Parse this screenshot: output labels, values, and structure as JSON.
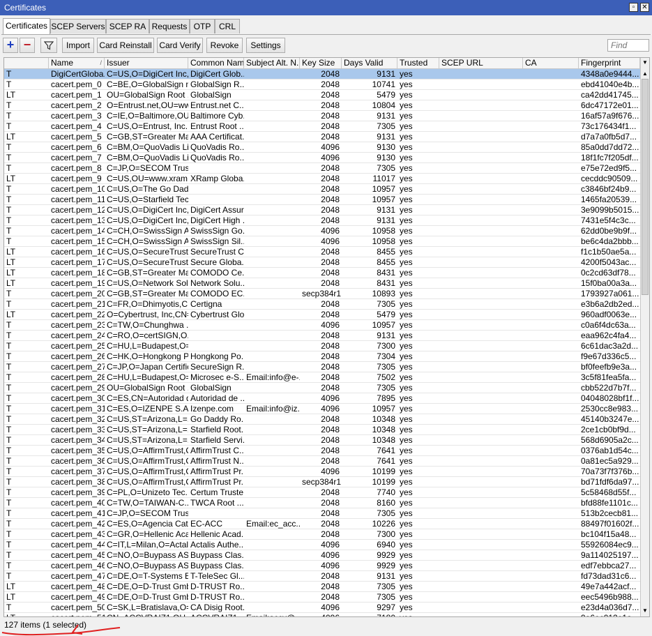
{
  "window": {
    "title": "Certificates"
  },
  "tabs": [
    "Certificates",
    "SCEP Servers",
    "SCEP RA",
    "Requests",
    "OTP",
    "CRL"
  ],
  "toolbar": {
    "add_symbol": "+",
    "remove_symbol": "−",
    "filter_icon": "filter-icon",
    "import_label": "Import",
    "card_reinstall_label": "Card Reinstall",
    "card_verify_label": "Card Verify",
    "revoke_label": "Revoke",
    "settings_label": "Settings",
    "find_placeholder": "Find"
  },
  "columns": [
    "",
    "Name",
    "Issuer",
    "Common Name",
    "Subject Alt. N...",
    "Key Size",
    "Days Valid",
    "Trusted",
    "SCEP URL",
    "CA",
    "Fingerprint"
  ],
  "rows": [
    [
      "T",
      "DigiCertGloba...",
      "C=US,O=DigiCert Inc,...",
      "DigiCert Glob...",
      "",
      "2048",
      "9131",
      "yes",
      "",
      "",
      "4348a0e9444..."
    ],
    [
      "T",
      "cacert.pem_0",
      "C=BE,O=GlobalSign n...",
      "GlobalSign R...",
      "",
      "2048",
      "10741",
      "yes",
      "",
      "",
      "ebd41040e4b..."
    ],
    [
      "LT",
      "cacert.pem_1",
      "OU=GlobalSign Root ...",
      "GlobalSign",
      "",
      "2048",
      "5479",
      "yes",
      "",
      "",
      "ca42dd41745..."
    ],
    [
      "T",
      "cacert.pem_2",
      "O=Entrust.net,OU=ww...",
      "Entrust.net C...",
      "",
      "2048",
      "10804",
      "yes",
      "",
      "",
      "6dc47172e01..."
    ],
    [
      "T",
      "cacert.pem_3",
      "C=IE,O=Baltimore,OU...",
      "Baltimore Cyb...",
      "",
      "2048",
      "9131",
      "yes",
      "",
      "",
      "16af57a9f676..."
    ],
    [
      "T",
      "cacert.pem_4",
      "C=US,O=Entrust, Inc.,...",
      "Entrust Root ...",
      "",
      "2048",
      "7305",
      "yes",
      "",
      "",
      "73c176434f1..."
    ],
    [
      "LT",
      "cacert.pem_5",
      "C=GB,ST=Greater Ma...",
      "AAA Certificat...",
      "",
      "2048",
      "9131",
      "yes",
      "",
      "",
      "d7a7a0fb5d7..."
    ],
    [
      "T",
      "cacert.pem_6",
      "C=BM,O=QuoVadis Li...",
      "QuoVadis Ro...",
      "",
      "4096",
      "9130",
      "yes",
      "",
      "",
      "85a0dd7dd72..."
    ],
    [
      "T",
      "cacert.pem_7",
      "C=BM,O=QuoVadis Li...",
      "QuoVadis Ro...",
      "",
      "4096",
      "9130",
      "yes",
      "",
      "",
      "18f1fc7f205df..."
    ],
    [
      "T",
      "cacert.pem_8",
      "C=JP,O=SECOM Trus...",
      "",
      "",
      "2048",
      "7305",
      "yes",
      "",
      "",
      "e75e72ed9f5..."
    ],
    [
      "LT",
      "cacert.pem_9",
      "C=US,OU=www.xram...",
      "XRamp Globa...",
      "",
      "2048",
      "11017",
      "yes",
      "",
      "",
      "cecddc90509..."
    ],
    [
      "T",
      "cacert.pem_10",
      "C=US,O=The Go Dad...",
      "",
      "",
      "2048",
      "10957",
      "yes",
      "",
      "",
      "c3846bf24b9..."
    ],
    [
      "T",
      "cacert.pem_11",
      "C=US,O=Starfield Tec...",
      "",
      "",
      "2048",
      "10957",
      "yes",
      "",
      "",
      "1465fa20539..."
    ],
    [
      "T",
      "cacert.pem_12",
      "C=US,O=DigiCert Inc,...",
      "DigiCert Assur...",
      "",
      "2048",
      "9131",
      "yes",
      "",
      "",
      "3e9099b5015..."
    ],
    [
      "T",
      "cacert.pem_13",
      "C=US,O=DigiCert Inc,...",
      "DigiCert High ...",
      "",
      "2048",
      "9131",
      "yes",
      "",
      "",
      "7431e5f4c3c..."
    ],
    [
      "T",
      "cacert.pem_14",
      "C=CH,O=SwissSign A...",
      "SwissSign Go...",
      "",
      "4096",
      "10958",
      "yes",
      "",
      "",
      "62dd0be9b9f..."
    ],
    [
      "T",
      "cacert.pem_15",
      "C=CH,O=SwissSign A...",
      "SwissSign Sil...",
      "",
      "4096",
      "10958",
      "yes",
      "",
      "",
      "be6c4da2bbb..."
    ],
    [
      "LT",
      "cacert.pem_16",
      "C=US,O=SecureTrust ...",
      "SecureTrust CA",
      "",
      "2048",
      "8455",
      "yes",
      "",
      "",
      "f1c1b50ae5a..."
    ],
    [
      "LT",
      "cacert.pem_17",
      "C=US,O=SecureTrust ...",
      "Secure Globa...",
      "",
      "2048",
      "8455",
      "yes",
      "",
      "",
      "4200f5043ac..."
    ],
    [
      "LT",
      "cacert.pem_18",
      "C=GB,ST=Greater Ma...",
      "COMODO Ce...",
      "",
      "2048",
      "8431",
      "yes",
      "",
      "",
      "0c2cd63df78..."
    ],
    [
      "LT",
      "cacert.pem_19",
      "C=US,O=Network Sol...",
      "Network Solu...",
      "",
      "2048",
      "8431",
      "yes",
      "",
      "",
      "15f0ba00a3a..."
    ],
    [
      "T",
      "cacert.pem_20",
      "C=GB,ST=Greater Ma...",
      "COMODO EC...",
      "",
      "secp384r1",
      "10893",
      "yes",
      "",
      "",
      "1793927a061..."
    ],
    [
      "T",
      "cacert.pem_21",
      "C=FR,O=Dhimyotis,C...",
      "Certigna",
      "",
      "2048",
      "7305",
      "yes",
      "",
      "",
      "e3b6a2db2ed..."
    ],
    [
      "LT",
      "cacert.pem_22",
      "O=Cybertrust, Inc,CN=...",
      "Cybertrust Glo...",
      "",
      "2048",
      "5479",
      "yes",
      "",
      "",
      "960adf0063e..."
    ],
    [
      "T",
      "cacert.pem_23",
      "C=TW,O=Chunghwa ...",
      "",
      "",
      "4096",
      "10957",
      "yes",
      "",
      "",
      "c0a6f4dc63a..."
    ],
    [
      "T",
      "cacert.pem_24",
      "C=RO,O=certSIGN,O...",
      "",
      "",
      "2048",
      "9131",
      "yes",
      "",
      "",
      "eaa962c4fa4..."
    ],
    [
      "T",
      "cacert.pem_25",
      "C=HU,L=Budapest,O=...",
      "",
      "",
      "2048",
      "7300",
      "yes",
      "",
      "",
      "6c61dac3a2d..."
    ],
    [
      "T",
      "cacert.pem_26",
      "C=HK,O=Hongkong P...",
      "Hongkong Po...",
      "",
      "2048",
      "7304",
      "yes",
      "",
      "",
      "f9e67d336c5..."
    ],
    [
      "T",
      "cacert.pem_27",
      "C=JP,O=Japan Certific...",
      "SecureSign R...",
      "",
      "2048",
      "7305",
      "yes",
      "",
      "",
      "bf0feefb9e3a..."
    ],
    [
      "T",
      "cacert.pem_28",
      "C=HU,L=Budapest,O=...",
      "Microsec e-S...",
      "Email:info@e-...",
      "2048",
      "7502",
      "yes",
      "",
      "",
      "3c5f81fea5fa..."
    ],
    [
      "T",
      "cacert.pem_29",
      "OU=GlobalSign Root ...",
      "GlobalSign",
      "",
      "2048",
      "7305",
      "yes",
      "",
      "",
      "cbb522d7b7f..."
    ],
    [
      "T",
      "cacert.pem_30",
      "C=ES,CN=Autoridad d...",
      "Autoridad de ...",
      "",
      "4096",
      "7895",
      "yes",
      "",
      "",
      "04048028bf1f..."
    ],
    [
      "T",
      "cacert.pem_31",
      "C=ES,O=IZENPE S.A....",
      "Izenpe.com",
      "Email:info@iz...",
      "4096",
      "10957",
      "yes",
      "",
      "",
      "2530cc8e983..."
    ],
    [
      "T",
      "cacert.pem_32",
      "C=US,ST=Arizona,L=...",
      "Go Daddy Ro...",
      "",
      "2048",
      "10348",
      "yes",
      "",
      "",
      "45140b3247e..."
    ],
    [
      "T",
      "cacert.pem_33",
      "C=US,ST=Arizona,L=...",
      "Starfield Root...",
      "",
      "2048",
      "10348",
      "yes",
      "",
      "",
      "2ce1cb0bf9d..."
    ],
    [
      "T",
      "cacert.pem_34",
      "C=US,ST=Arizona,L=...",
      "Starfield Servi...",
      "",
      "2048",
      "10348",
      "yes",
      "",
      "",
      "568d6905a2c..."
    ],
    [
      "T",
      "cacert.pem_35",
      "C=US,O=AffirmTrust,C...",
      "AffirmTrust C...",
      "",
      "2048",
      "7641",
      "yes",
      "",
      "",
      "0376ab1d54c..."
    ],
    [
      "T",
      "cacert.pem_36",
      "C=US,O=AffirmTrust,C...",
      "AffirmTrust N...",
      "",
      "2048",
      "7641",
      "yes",
      "",
      "",
      "0a81ec5a929..."
    ],
    [
      "T",
      "cacert.pem_37",
      "C=US,O=AffirmTrust,C...",
      "AffirmTrust Pr...",
      "",
      "4096",
      "10199",
      "yes",
      "",
      "",
      "70a73f7f376b..."
    ],
    [
      "T",
      "cacert.pem_38",
      "C=US,O=AffirmTrust,C...",
      "AffirmTrust Pr...",
      "",
      "secp384r1",
      "10199",
      "yes",
      "",
      "",
      "bd71fdf6da97..."
    ],
    [
      "T",
      "cacert.pem_39",
      "C=PL,O=Unizeto Tec...",
      "Certum Truste...",
      "",
      "2048",
      "7740",
      "yes",
      "",
      "",
      "5c58468d55f..."
    ],
    [
      "T",
      "cacert.pem_40",
      "C=TW,O=TAIWAN-C...",
      "TWCA Root ...",
      "",
      "2048",
      "8160",
      "yes",
      "",
      "",
      "bfd88fe1101c..."
    ],
    [
      "T",
      "cacert.pem_41",
      "C=JP,O=SECOM Trus...",
      "",
      "",
      "2048",
      "7305",
      "yes",
      "",
      "",
      "513b2cecb81..."
    ],
    [
      "T",
      "cacert.pem_42",
      "C=ES,O=Agencia Cat...",
      "EC-ACC",
      "Email:ec_acc...",
      "2048",
      "10226",
      "yes",
      "",
      "",
      "88497f01602f..."
    ],
    [
      "T",
      "cacert.pem_43",
      "C=GR,O=Hellenic Aca...",
      "Hellenic Acad...",
      "",
      "2048",
      "7300",
      "yes",
      "",
      "",
      "bc104f15a48..."
    ],
    [
      "T",
      "cacert.pem_44",
      "C=IT,L=Milan,O=Actali...",
      "Actalis Authe...",
      "",
      "4096",
      "6940",
      "yes",
      "",
      "",
      "55926084ec9..."
    ],
    [
      "T",
      "cacert.pem_45",
      "C=NO,O=Buypass AS-...",
      "Buypass Clas...",
      "",
      "4096",
      "9929",
      "yes",
      "",
      "",
      "9a114025197..."
    ],
    [
      "T",
      "cacert.pem_46",
      "C=NO,O=Buypass AS-...",
      "Buypass Clas...",
      "",
      "4096",
      "9929",
      "yes",
      "",
      "",
      "edf7ebbca27..."
    ],
    [
      "T",
      "cacert.pem_47",
      "C=DE,O=T-Systems E...",
      "T-TeleSec Gl...",
      "",
      "2048",
      "9131",
      "yes",
      "",
      "",
      "fd73dad31c6..."
    ],
    [
      "LT",
      "cacert.pem_48",
      "C=DE,O=D-Trust Gmb...",
      "D-TRUST Ro...",
      "",
      "2048",
      "7305",
      "yes",
      "",
      "",
      "49e7a442acf..."
    ],
    [
      "LT",
      "cacert.pem_49",
      "C=DE,O=D-Trust Gmb...",
      "D-TRUST Ro...",
      "",
      "2048",
      "7305",
      "yes",
      "",
      "",
      "eec5496b988..."
    ],
    [
      "T",
      "cacert.pem_50",
      "C=SK,L=Bratislava,O=...",
      "CA Disig Root...",
      "",
      "4096",
      "9297",
      "yes",
      "",
      "",
      "e23d4a036d7..."
    ],
    [
      "LT",
      "cacert.pem_51",
      "CN=ACCVRAIZ1,OU=...",
      "ACCVRAIZ1",
      "Email:accv@...",
      "4096",
      "7180",
      "yes",
      "",
      "",
      "9a6ec012e1a..."
    ]
  ],
  "status": {
    "text": "127 items (1 selected)"
  },
  "colors": {
    "titlebar": "#3c5fb8",
    "selection": "#a9c8ec",
    "add_icon": "#1f3fbf",
    "remove_icon": "#c0202a",
    "annotation": "#e02020"
  }
}
